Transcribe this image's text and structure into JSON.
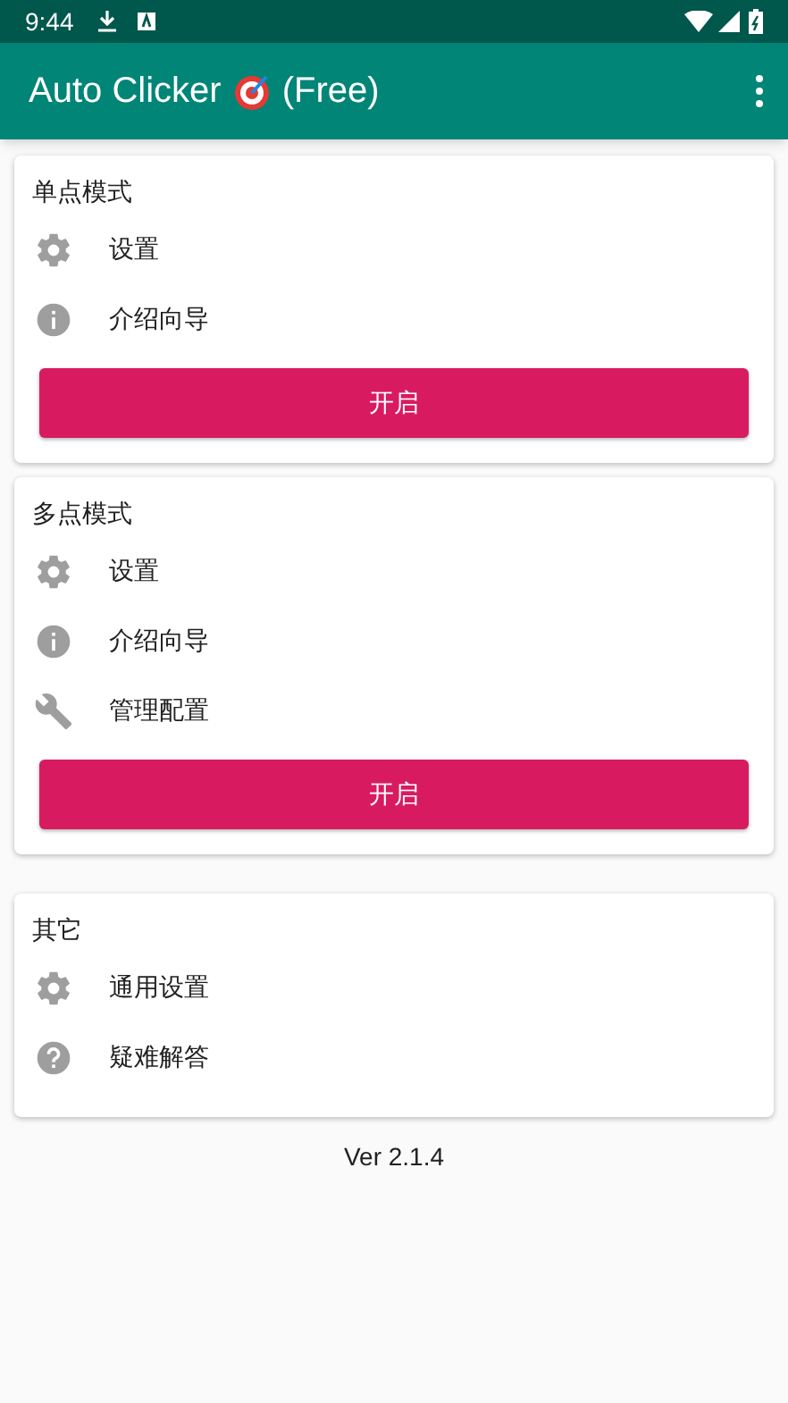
{
  "status_bar": {
    "time": "9:44"
  },
  "app_bar": {
    "title": "Auto Clicker",
    "title_suffix": "(Free)"
  },
  "cards": [
    {
      "title": "单点模式",
      "items": [
        {
          "kind": "gear",
          "label": "设置"
        },
        {
          "kind": "info",
          "label": "介绍向导"
        }
      ],
      "button": "开启"
    },
    {
      "title": "多点模式",
      "items": [
        {
          "kind": "gear",
          "label": "设置"
        },
        {
          "kind": "info",
          "label": "介绍向导"
        },
        {
          "kind": "wrench",
          "label": "管理配置"
        }
      ],
      "button": "开启"
    },
    {
      "title": "其它",
      "items": [
        {
          "kind": "gear",
          "label": "通用设置"
        },
        {
          "kind": "help",
          "label": "疑难解答"
        }
      ]
    }
  ],
  "version": "Ver 2.1.4"
}
